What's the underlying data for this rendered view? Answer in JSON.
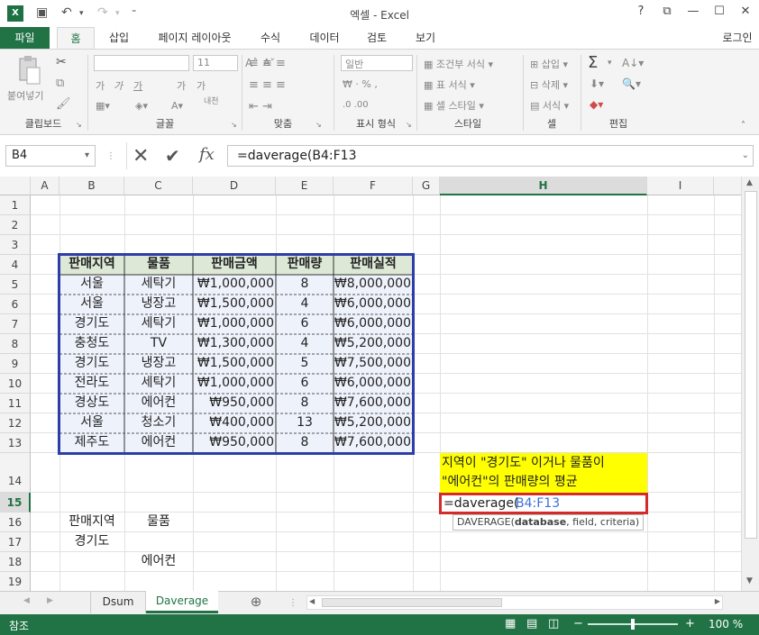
{
  "window": {
    "title": "엑셀 - Excel",
    "help": "?",
    "restore": "⧉",
    "minimize": "—",
    "maximize": "☐",
    "close": "✕"
  },
  "app_logo": "X",
  "tabs": [
    "파일",
    "홈",
    "삽입",
    "페이지 레이아웃",
    "수식",
    "데이터",
    "검토",
    "보기"
  ],
  "login": "로그인",
  "ribbon": {
    "groups": [
      "클립보드",
      "글꼴",
      "맞춤",
      "표시 형식",
      "스타일",
      "셀",
      "편집"
    ],
    "paste": "붙여넣기",
    "font_size": "11",
    "font_buttons": [
      "가",
      "가",
      "가",
      "가",
      "가"
    ],
    "number_format": "일반",
    "styles": [
      "조건부 서식",
      "표 서식",
      "셀 스타일"
    ],
    "cells": [
      "삽입",
      "삭제",
      "서식"
    ],
    "wrap_label": "내천"
  },
  "formula_bar": {
    "name_box": "B4",
    "formula": "=daverage(B4:F13",
    "fx": "fx"
  },
  "columns": [
    "A",
    "B",
    "C",
    "D",
    "E",
    "F",
    "G",
    "H",
    "I"
  ],
  "rows": [
    "1",
    "2",
    "3",
    "4",
    "5",
    "6",
    "7",
    "8",
    "9",
    "10",
    "11",
    "12",
    "13",
    "14",
    "15",
    "16",
    "17",
    "18",
    "19"
  ],
  "table": {
    "headers": [
      "판매지역",
      "물품",
      "판매금액",
      "판매량",
      "판매실적"
    ],
    "rows": [
      [
        "서울",
        "세탁기",
        "₩1,000,000",
        "8",
        "₩8,000,000"
      ],
      [
        "서울",
        "냉장고",
        "₩1,500,000",
        "4",
        "₩6,000,000"
      ],
      [
        "경기도",
        "세탁기",
        "₩1,000,000",
        "6",
        "₩6,000,000"
      ],
      [
        "충청도",
        "TV",
        "₩1,300,000",
        "4",
        "₩5,200,000"
      ],
      [
        "경기도",
        "냉장고",
        "₩1,500,000",
        "5",
        "₩7,500,000"
      ],
      [
        "전라도",
        "세탁기",
        "₩1,000,000",
        "6",
        "₩6,000,000"
      ],
      [
        "경상도",
        "에어컨",
        "₩950,000",
        "8",
        "₩7,600,000"
      ],
      [
        "서울",
        "청소기",
        "₩400,000",
        "13",
        "₩5,200,000"
      ],
      [
        "제주도",
        "에어컨",
        "₩950,000",
        "8",
        "₩7,600,000"
      ]
    ]
  },
  "criteria": {
    "h1": "판매지역",
    "h2": "물품",
    "v1": "경기도",
    "v2": "에어컨"
  },
  "note": {
    "line1": "지역이 \"경기도\" 이거나 물품이",
    "line2": "\"에어컨\"의 판매량의 평균"
  },
  "edit_cell": {
    "prefix": "=daverage(",
    "ref": "B4:F13"
  },
  "tooltip": {
    "fn": "DAVERAGE(",
    "arg1": "database",
    "rest": ", field, criteria)"
  },
  "sheets": [
    "Dsum",
    "Daverage"
  ],
  "add_sheet": "⊕",
  "status": {
    "mode": "참조",
    "zoom": "100 %"
  },
  "colors": {
    "accent": "#217346",
    "table_border": "#2e3ea8",
    "note_bg": "#ffff00",
    "edit_border": "#d42a2a",
    "ref_blue": "#3f6fd8"
  }
}
